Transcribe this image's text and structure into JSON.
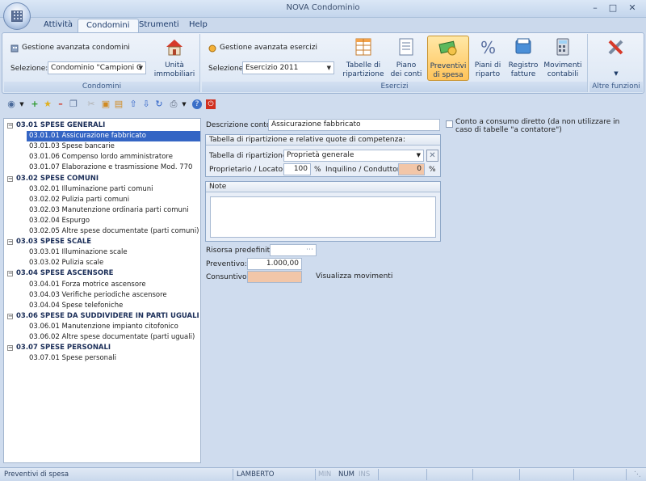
{
  "window": {
    "title": "NOVA Condominio"
  },
  "tabs": [
    {
      "label": "Attività"
    },
    {
      "label": "Condomini"
    },
    {
      "label": "Strumenti"
    },
    {
      "label": "Help"
    }
  ],
  "ribbon": {
    "condomini": {
      "header": "Gestione avanzata condomini",
      "selection_label": "Selezione:",
      "selection_value": "Condominio \"Campioni C",
      "unita_label": "Unità\nimmobiliari",
      "group_label": "Condomini"
    },
    "esercizi": {
      "header": "Gestione avanzata esercizi",
      "selection_label": "Selezione:",
      "selection_value": "Esercizio 2011",
      "buttons": [
        {
          "label": "Tabelle di\nripartizione"
        },
        {
          "label": "Piano\ndei conti"
        },
        {
          "label": "Preventivi\ndi spesa"
        },
        {
          "label": "Piani di\nriparto"
        },
        {
          "label": "Registro\nfatture"
        },
        {
          "label": "Movimenti\ncontabili"
        }
      ],
      "group_label": "Esercizi"
    },
    "altre": {
      "group_label": "Altre funzioni"
    }
  },
  "tree": [
    {
      "label": "03.01 SPESE GENERALI",
      "group": true
    },
    {
      "label": "03.01.01 Assicurazione fabbricato",
      "selected": true
    },
    {
      "label": "03.01.03 Spese bancarie"
    },
    {
      "label": "03.01.06 Compenso lordo amministratore"
    },
    {
      "label": "03.01.07 Elaborazione e trasmissione Mod. 770"
    },
    {
      "label": "03.02 SPESE COMUNI",
      "group": true
    },
    {
      "label": "03.02.01 Illuminazione parti comuni"
    },
    {
      "label": "03.02.02 Pulizia parti comuni"
    },
    {
      "label": "03.02.03 Manutenzione ordinaria parti comuni"
    },
    {
      "label": "03.02.04 Espurgo"
    },
    {
      "label": "03.02.05 Altre spese documentate (parti comuni)"
    },
    {
      "label": "03.03 SPESE SCALE",
      "group": true
    },
    {
      "label": "03.03.01 Illuminazione scale"
    },
    {
      "label": "03.03.02 Pulizia scale"
    },
    {
      "label": "03.04 SPESE ASCENSORE",
      "group": true
    },
    {
      "label": "03.04.01 Forza motrice ascensore"
    },
    {
      "label": "03.04.03 Verifiche periodiche ascensore"
    },
    {
      "label": "03.04.04 Spese telefoniche"
    },
    {
      "label": "03.06 SPESE DA SUDDIVIDERE IN PARTI UGUALI",
      "group": true
    },
    {
      "label": "03.06.01 Manutenzione impianto citofonico"
    },
    {
      "label": "03.06.02 Altre spese documentate (parti uguali)"
    },
    {
      "label": "03.07 SPESE PERSONALI",
      "group": true
    },
    {
      "label": "03.07.01 Spese personali"
    }
  ],
  "form": {
    "descrizione_label": "Descrizione conto:",
    "descrizione_value": "Assicurazione fabbricato",
    "consumo_label": "Conto a consumo diretto (da non utilizzare in caso di tabelle \"a contatore\")",
    "tabella_box_title": "Tabella di ripartizione e relative quote di competenza:",
    "tabella_label": "Tabella di ripartizione:",
    "tabella_value": "Proprietà generale",
    "proprietario_label": "Proprietario / Locatore:",
    "proprietario_value": "100",
    "inquilino_label": "Inquilino / Conduttore:",
    "inquilino_value": "0",
    "percent": "%",
    "note_title": "Note",
    "risorsa_label": "Risorsa predefinita:",
    "preventivo_label": "Preventivo:",
    "preventivo_value": "1.000,00",
    "consuntivo_label": "Consuntivo:",
    "visualizza_label": "Visualizza movimenti"
  },
  "statusbar": {
    "left": "Preventivi di spesa",
    "user": "LAMBERTO",
    "min": "MIN",
    "num": "NUM",
    "ins": "INS"
  }
}
